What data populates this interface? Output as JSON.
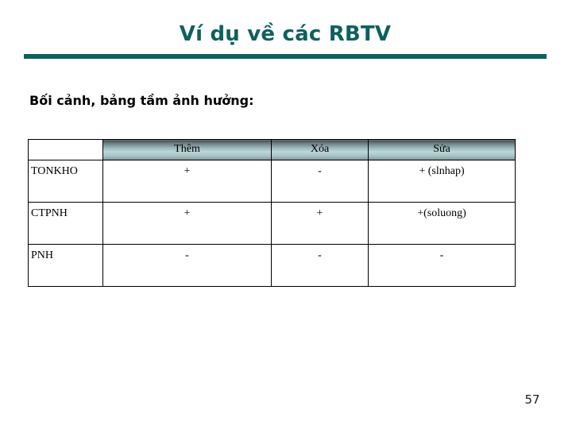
{
  "slide": {
    "title": "Ví dụ về các RBTV",
    "subtitle": "Bối cảnh, bảng tầm ảnh hưởng:",
    "page_number": "57",
    "accent_color": "#0d6160",
    "header_gradient_top": "#404d4d",
    "header_gradient_mid": "#bcd6da",
    "header_gradient_bottom": "#7d9497",
    "text_color": "#000000",
    "background_color": "#ffffff"
  },
  "table": {
    "corner_label": "",
    "columns": [
      "Thêm",
      "Xóa",
      "Sửa"
    ],
    "rows": [
      {
        "label": "TONKHO",
        "values": [
          "+",
          "-",
          "+ (slnhap)"
        ]
      },
      {
        "label": "CTPNH",
        "values": [
          "+",
          "+",
          "+(soluong)"
        ]
      },
      {
        "label": "PNH",
        "values": [
          "-",
          "-",
          "-"
        ]
      }
    ]
  }
}
